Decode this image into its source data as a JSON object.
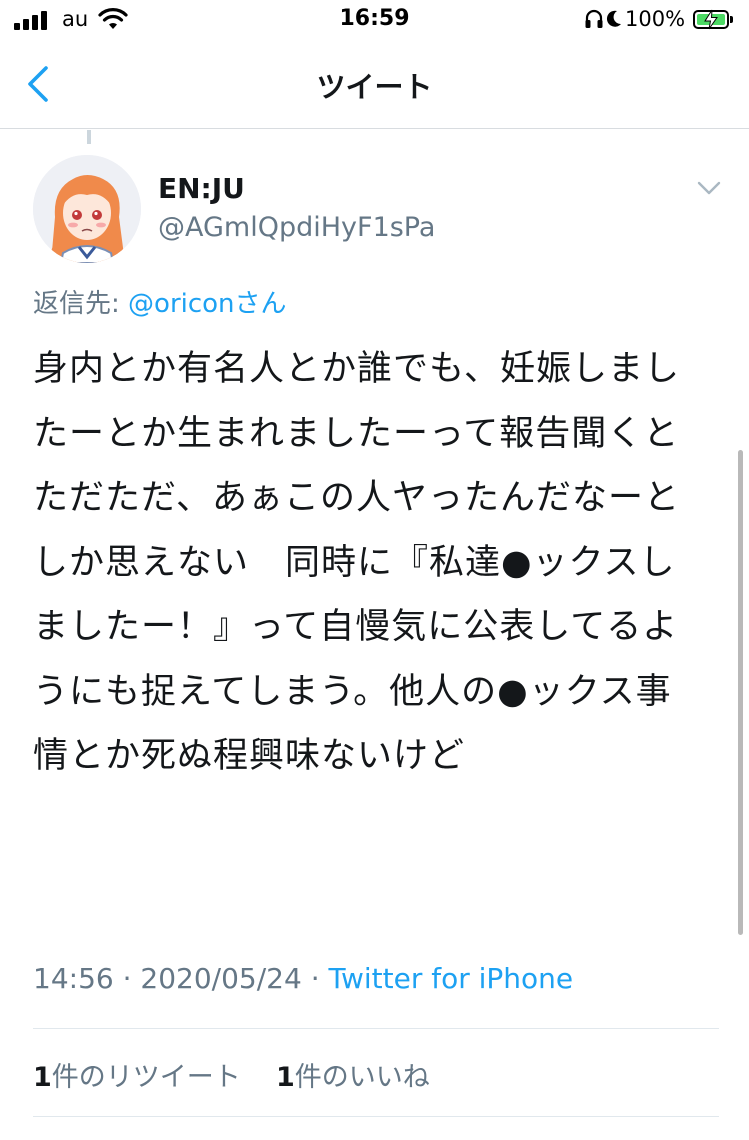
{
  "status_bar": {
    "carrier": "au",
    "time": "16:59",
    "battery_percent": "100%",
    "signal_bars": 4,
    "icons": [
      "wifi-icon",
      "headphones-icon",
      "moon-icon",
      "battery-icon",
      "charging-bolt-icon"
    ]
  },
  "nav": {
    "title": "ツイート",
    "back_icon": "chevron-left-icon"
  },
  "tweet": {
    "display_name": "EN:JU",
    "handle": "@AGmlQpdiHyF1sPa",
    "reply_prefix": "返信先: ",
    "reply_mention": "@oriconさん",
    "text": "身内とか有名人とか誰でも、妊娠しましたーとか生まれましたーって報告聞くと　ただただ、あぁこの人ヤったんだなーとしか思えない　同時に『私達●ックスしましたー！』って自慢気に公表してるようにも捉えてしまう。他人の●ックス事情とか死ぬ程興味ないけど",
    "time": "14:56",
    "separator": " · ",
    "date": "2020/05/24",
    "source": "Twitter for iPhone",
    "retweet_count": "1",
    "retweet_label": "件のリツイート",
    "like_count": "1",
    "like_label": "件のいいね"
  },
  "colors": {
    "link": "#1da1f2",
    "secondary_text": "#657786",
    "primary_text": "#14171a",
    "battery_fill": "#4cd964",
    "divider": "#e1e8ed"
  }
}
